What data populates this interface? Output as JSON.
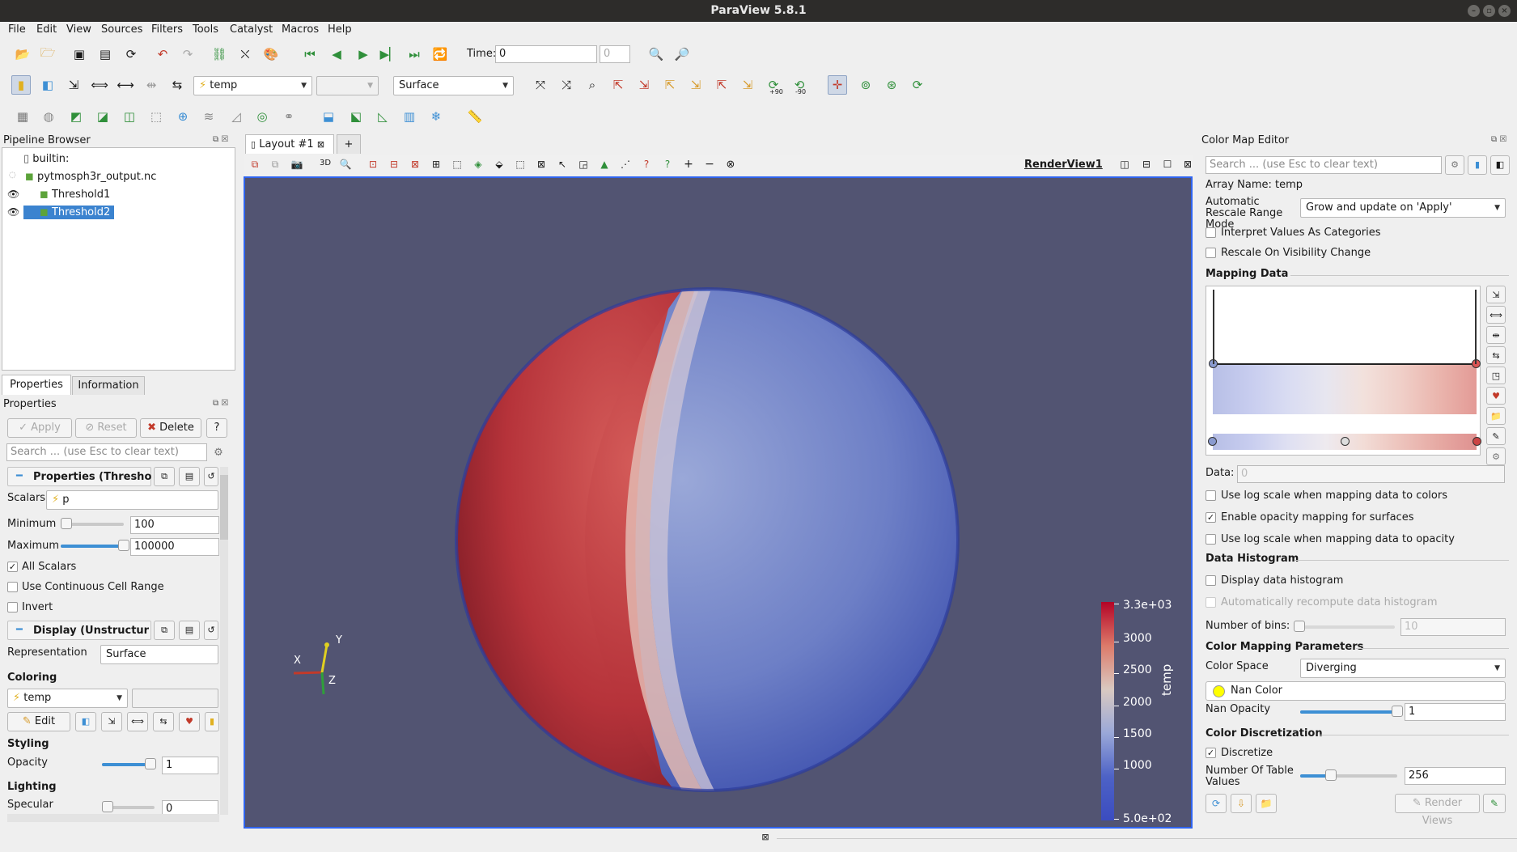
{
  "window": {
    "title": "ParaView 5.8.1"
  },
  "menu": [
    "File",
    "Edit",
    "View",
    "Sources",
    "Filters",
    "Tools",
    "Catalyst",
    "Macros",
    "Help"
  ],
  "time_toolbar": {
    "time_label": "Time:",
    "time_value": "0",
    "step_value": "0"
  },
  "toolbar2": {
    "array_value": "temp",
    "component_value": "",
    "representation_value": "Surface",
    "rot_plus": "+90",
    "rot_minus": "-90"
  },
  "pipeline": {
    "title": "Pipeline Browser",
    "items": [
      {
        "label": "builtin:"
      },
      {
        "label": "pytmosph3r_output.nc"
      },
      {
        "label": "Threshold1"
      },
      {
        "label": "Threshold2"
      }
    ]
  },
  "tabs": {
    "properties": "Properties",
    "information": "Information"
  },
  "properties": {
    "title": "Properties",
    "apply": "Apply",
    "reset": "Reset",
    "delete": "Delete",
    "help": "?",
    "search_placeholder": "Search ... (use Esc to clear text)",
    "section1": "Properties (Thresho",
    "scalars_label": "Scalars",
    "scalars_value": "p",
    "minimum_label": "Minimum",
    "minimum_value": "100",
    "minimum_fraction": 0.0,
    "maximum_label": "Maximum",
    "maximum_value": "100000",
    "maximum_fraction": 1.0,
    "all_scalars": "All Scalars",
    "continuous": "Use Continuous Cell Range",
    "invert": "Invert",
    "section2": "Display (Unstructur",
    "representation_label": "Representation",
    "representation_value": "Surface",
    "coloring_label": "Coloring",
    "coloring_value": "temp",
    "edit": "Edit",
    "styling_label": "Styling",
    "opacity_label": "Opacity",
    "opacity_value": "1",
    "lighting_label": "Lighting",
    "specular_label": "Specular",
    "specular_value": "0"
  },
  "layout": {
    "tab": "Layout #1",
    "plus": "+",
    "view_name": "RenderView1",
    "three_d": "3D"
  },
  "scalar_bar": {
    "title": "temp",
    "ticks": [
      "3.3e+03",
      "3000",
      "2500",
      "2000",
      "1500",
      "1000",
      "5.0e+02"
    ]
  },
  "axes": {
    "x": "X",
    "y": "Y",
    "z": "Z"
  },
  "colormap": {
    "title": "Color Map Editor",
    "search_placeholder": "Search ... (use Esc to clear text)",
    "array_name": "Array Name: temp",
    "rescale_label": "Automatic Rescale Range Mode",
    "rescale_value": "Grow and update on 'Apply'",
    "interpret": "Interpret Values As Categories",
    "rescale_visibility": "Rescale On Visibility Change",
    "mapping_data": "Mapping Data",
    "data_label": "Data:",
    "data_value": "0",
    "log_colors": "Use log scale when mapping data to colors",
    "opacity_mapping": "Enable opacity mapping for surfaces",
    "log_opacity": "Use log scale when mapping data to opacity",
    "data_histogram": "Data Histogram",
    "display_histogram": "Display data histogram",
    "auto_recompute": "Automatically recompute data histogram",
    "bins_label": "Number of bins:",
    "bins_value": "10",
    "color_mapping_params": "Color Mapping Parameters",
    "color_space_label": "Color Space",
    "color_space_value": "Diverging",
    "nan_color": "Nan Color",
    "nan_opacity_label": "Nan Opacity",
    "nan_opacity_value": "1",
    "nan_opacity_fraction": 1.0,
    "discretization": "Color Discretization",
    "discretize": "Discretize",
    "table_values_label": "Number Of Table Values",
    "table_values_value": "256",
    "render_views": "Render Views"
  },
  "colors": {
    "accent": "#3d8fd4",
    "view_bg": "#525472",
    "selection": "#3b83cf",
    "cold": "#3b4cc0",
    "hot": "#b40426"
  }
}
